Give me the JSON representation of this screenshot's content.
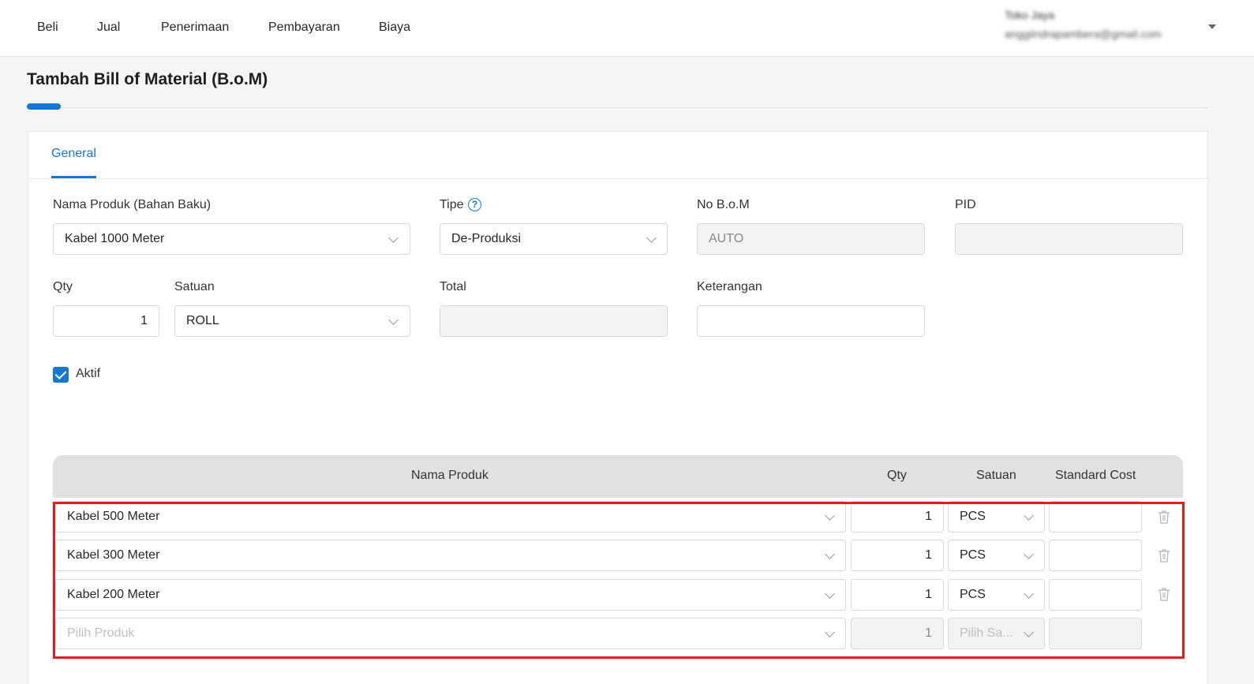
{
  "nav": {
    "items": [
      "Beli",
      "Jual",
      "Penerimaan",
      "Pembayaran",
      "Biaya"
    ],
    "user_name": "Toko Jaya",
    "user_email": "anggiindrapambera@gmail.com"
  },
  "page": {
    "title": "Tambah Bill of Material (B.o.M)"
  },
  "tabs": {
    "active": "General"
  },
  "form": {
    "nama_produk_label": "Nama Produk (Bahan Baku)",
    "nama_produk_value": "Kabel 1000 Meter",
    "tipe_label": "Tipe",
    "tipe_value": "De-Produksi",
    "no_bom_label": "No B.o.M",
    "no_bom_value": "AUTO",
    "pid_label": "PID",
    "pid_value": "",
    "qty_label": "Qty",
    "qty_value": "1",
    "satuan_label": "Satuan",
    "satuan_value": "ROLL",
    "total_label": "Total",
    "total_value": "",
    "keterangan_label": "Keterangan",
    "keterangan_value": "",
    "aktif_label": "Aktif",
    "aktif_checked": true
  },
  "table": {
    "headers": {
      "nama_produk": "Nama Produk",
      "qty": "Qty",
      "satuan": "Satuan",
      "standard_cost": "Standard Cost"
    },
    "rows": [
      {
        "product": "Kabel 500 Meter",
        "qty": "1",
        "satuan": "PCS",
        "standard_cost": ""
      },
      {
        "product": "Kabel 300 Meter",
        "qty": "1",
        "satuan": "PCS",
        "standard_cost": ""
      },
      {
        "product": "Kabel 200 Meter",
        "qty": "1",
        "satuan": "PCS",
        "standard_cost": ""
      }
    ],
    "empty_row": {
      "product_placeholder": "Pilih Produk",
      "qty": "1",
      "satuan_placeholder": "Pilih Sa..."
    }
  },
  "colors": {
    "accent": "#1677d2",
    "highlight": "#e11d22",
    "header_bg": "#e1e1e1"
  }
}
